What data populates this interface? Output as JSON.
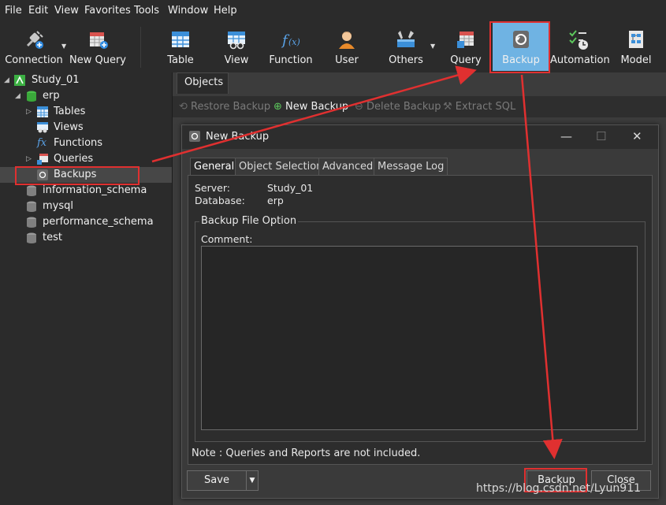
{
  "menubar": {
    "items": [
      "File",
      "Edit",
      "View",
      "Favorites",
      "Tools",
      "Window",
      "Help"
    ]
  },
  "toolbar": {
    "connection": "Connection",
    "new_query": "New Query",
    "table": "Table",
    "view": "View",
    "function": "Function",
    "user": "User",
    "others": "Others",
    "query": "Query",
    "backup": "Backup",
    "automation": "Automation",
    "model": "Model"
  },
  "sidebar": {
    "connection": "Study_01",
    "database": "erp",
    "items": [
      "Tables",
      "Views",
      "Functions",
      "Queries",
      "Backups"
    ],
    "other_databases": [
      "information_schema",
      "mysql",
      "performance_schema",
      "test"
    ]
  },
  "main": {
    "tab": "Objects",
    "object_toolbar": {
      "restore": "Restore Backup",
      "new": "New Backup",
      "delete": "Delete Backup",
      "extract": "Extract SQL"
    }
  },
  "dialog": {
    "title": "New Backup",
    "tabs": [
      "General",
      "Object Selection",
      "Advanced",
      "Message Log"
    ],
    "server_label": "Server:",
    "server_value": "Study_01",
    "database_label": "Database:",
    "database_value": "erp",
    "group_title": "Backup File Option",
    "comment_label": "Comment:",
    "comment_value": "",
    "note": "Note : Queries and Reports are not included.",
    "save_label": "Save",
    "backup_label": "Backup",
    "close_label": "Close"
  },
  "watermark": "https://blog.csdn.net/Lyun911",
  "colors": {
    "highlight": "#e03030",
    "backup_selected": "#6fb3e3",
    "dark_bg": "#2b2b2b"
  }
}
